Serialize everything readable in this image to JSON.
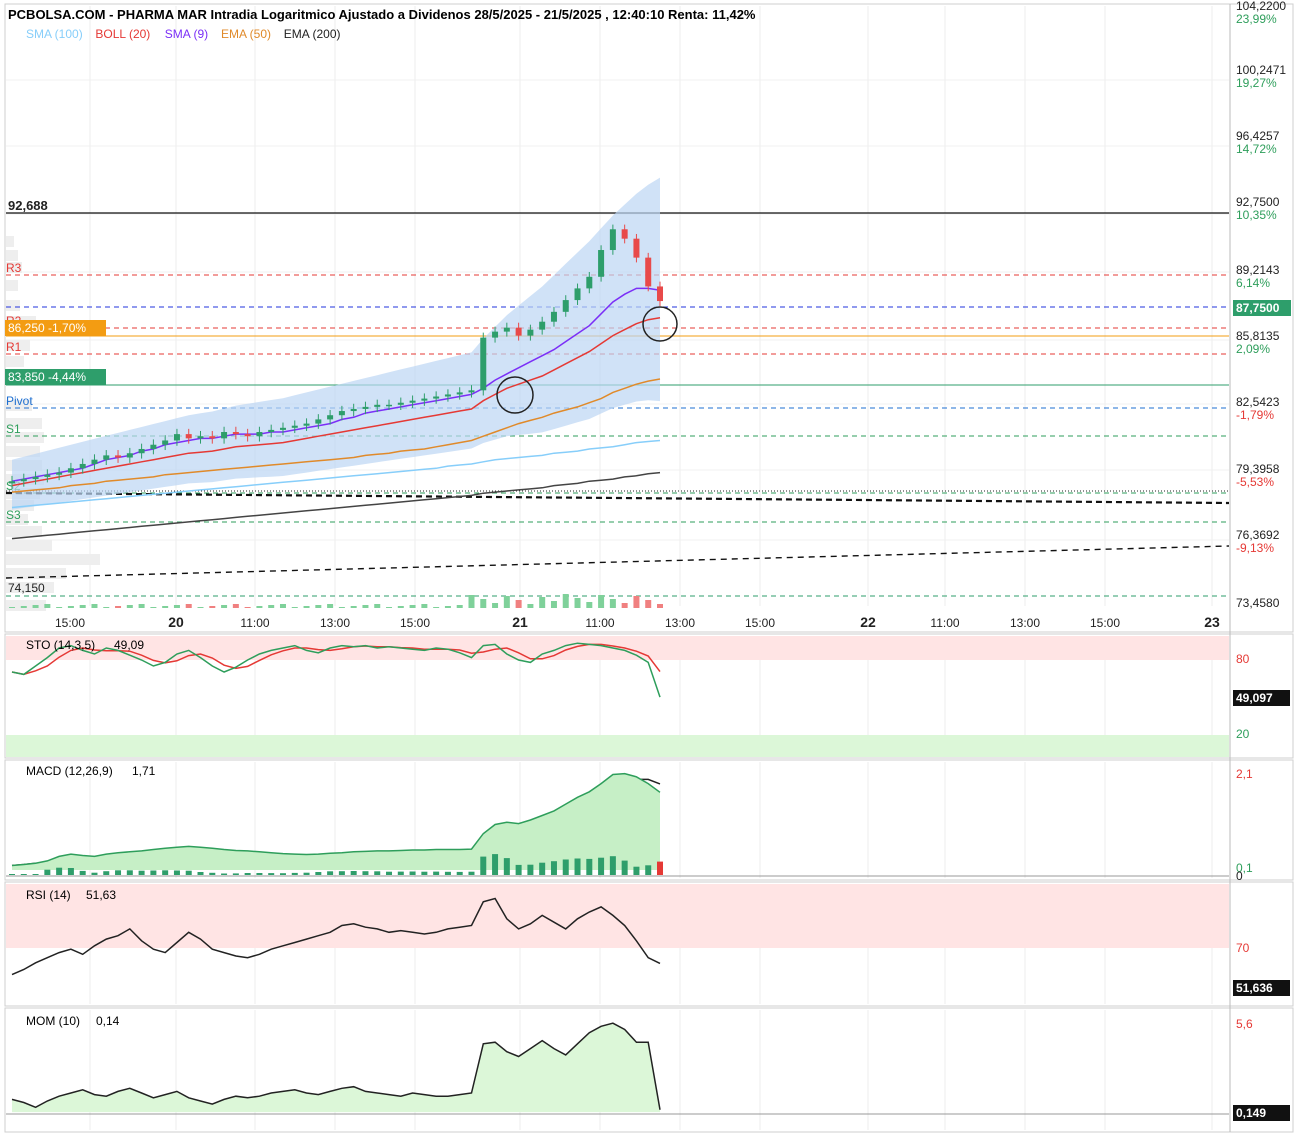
{
  "title": "PCBOLSA.COM - PHARMA MAR Intradia Logaritmico Ajustado a Dividenos 28/5/2025 - 21/5/2025 , 12:40:10 Renta: 11,42%",
  "legend": [
    {
      "label": "SMA (100)",
      "color": "#87cefa"
    },
    {
      "label": "BOLL (20)",
      "color": "#e53935"
    },
    {
      "label": "SMA (9)",
      "color": "#7b2ff7"
    },
    {
      "label": "EMA (50)",
      "color": "#e08a2a"
    },
    {
      "label": "EMA (200)",
      "color": "#222222"
    }
  ],
  "price_axis": [
    {
      "value": "104,2200",
      "pct": "23,99%",
      "pct_color": "#2e9e5b"
    },
    {
      "value": "100,2471",
      "pct": "19,27%",
      "pct_color": "#2e9e5b"
    },
    {
      "value": "96,4257",
      "pct": "14,72%",
      "pct_color": "#2e9e5b"
    },
    {
      "value": "92,7500",
      "pct": "10,35%",
      "pct_color": "#2e9e5b"
    },
    {
      "value": "89,2143",
      "pct": "6,14%",
      "pct_color": "#2e9e5b"
    },
    {
      "value": "85,8135",
      "pct": "2,09%",
      "pct_color": "#2e9e5b"
    },
    {
      "value": "82,5423",
      "pct": "-1,79%",
      "pct_color": "#e53935"
    },
    {
      "value": "79,3958",
      "pct": "-5,53%",
      "pct_color": "#e53935"
    },
    {
      "value": "76,3692",
      "pct": "-9,13%",
      "pct_color": "#e53935"
    },
    {
      "value": "73,4580",
      "pct": "",
      "pct_color": "#e53935"
    }
  ],
  "last_price_label": "87,7500",
  "high_label": "92,688",
  "low_label": "74,150",
  "pivot_levels": [
    {
      "label": "R3",
      "color": "#e53935"
    },
    {
      "label": "R2",
      "color": "#e53935"
    },
    {
      "label": "R1",
      "color": "#e53935"
    },
    {
      "label": "Pivot",
      "color": "#1e6fd0"
    },
    {
      "label": "S1",
      "color": "#2e9e5b"
    },
    {
      "label": "S2",
      "color": "#2e9e5b"
    },
    {
      "label": "S3",
      "color": "#2e9e5b"
    }
  ],
  "marker_orange": "86,250 -1,70%",
  "marker_green": "83,850 -4,44%",
  "time_axis": [
    "15:00",
    "20",
    "11:00",
    "13:00",
    "15:00",
    "21",
    "11:00",
    "13:00",
    "15:00",
    "22",
    "11:00",
    "13:00",
    "15:00",
    "23"
  ],
  "indicators": {
    "sto": {
      "title": "STO (14,3,5)",
      "value": "49,09",
      "box": "49,097",
      "levels": [
        "80",
        "20"
      ]
    },
    "macd": {
      "title": "MACD (12,26,9)",
      "value": "1,71",
      "levels": [
        "2,1",
        "0,1",
        "0"
      ]
    },
    "rsi": {
      "title": "RSI (14)",
      "value": "51,63",
      "box": "51,636",
      "levels": [
        "70"
      ]
    },
    "mom": {
      "title": "MOM (10)",
      "value": "0,14",
      "box": "0,149",
      "levels": [
        "5,6"
      ]
    }
  },
  "chart_data": {
    "type": "line",
    "title": "PCBOLSA.COM - PHARMA MAR Intradia Logaritmico Ajustado a Dividenos 28/5/2025 - 21/5/2025 , 12:40:10 Renta: 11,42%",
    "x_ticks": [
      "15:00",
      "20",
      "11:00",
      "13:00",
      "15:00",
      "21",
      "11:00",
      "13:00",
      "15:00",
      "22",
      "11:00",
      "13:00",
      "15:00",
      "23"
    ],
    "y_scale": "log",
    "ylim": [
      73.458,
      104.22
    ],
    "candles_close": [
      79.0,
      79.1,
      79.2,
      79.3,
      79.4,
      79.6,
      79.8,
      80.0,
      80.2,
      80.1,
      80.3,
      80.5,
      80.7,
      80.9,
      81.2,
      81.0,
      81.1,
      81.0,
      81.3,
      81.2,
      81.1,
      81.3,
      81.4,
      81.5,
      81.6,
      81.7,
      81.9,
      82.1,
      82.3,
      82.4,
      82.5,
      82.6,
      82.6,
      82.7,
      82.8,
      82.9,
      83.0,
      83.1,
      83.2,
      83.3,
      85.9,
      86.2,
      86.4,
      86.0,
      86.3,
      86.7,
      87.2,
      87.8,
      88.4,
      89.0,
      90.4,
      91.5,
      91.0,
      90.0,
      88.5,
      87.75
    ],
    "sma9": [
      79.0,
      79.1,
      79.2,
      79.3,
      79.4,
      79.5,
      79.6,
      79.8,
      80.0,
      80.1,
      80.2,
      80.4,
      80.5,
      80.7,
      80.8,
      80.9,
      81.0,
      81.0,
      81.1,
      81.2,
      81.2,
      81.2,
      81.3,
      81.3,
      81.4,
      81.5,
      81.6,
      81.7,
      81.9,
      82.0,
      82.2,
      82.3,
      82.4,
      82.5,
      82.6,
      82.7,
      82.8,
      82.9,
      83.0,
      83.1,
      83.4,
      83.8,
      84.1,
      84.4,
      84.7,
      85.0,
      85.3,
      85.7,
      86.1,
      86.5,
      87.1,
      87.7,
      88.1,
      88.4,
      88.4,
      88.3
    ],
    "ema50": [
      78.5,
      78.55,
      78.6,
      78.65,
      78.7,
      78.8,
      78.85,
      78.9,
      79.0,
      79.05,
      79.1,
      79.15,
      79.2,
      79.3,
      79.35,
      79.4,
      79.45,
      79.5,
      79.55,
      79.6,
      79.65,
      79.7,
      79.75,
      79.8,
      79.85,
      79.9,
      79.95,
      80.0,
      80.05,
      80.1,
      80.2,
      80.25,
      80.3,
      80.4,
      80.45,
      80.5,
      80.6,
      80.7,
      80.8,
      80.9,
      81.1,
      81.3,
      81.5,
      81.7,
      81.85,
      82.0,
      82.2,
      82.35,
      82.5,
      82.7,
      82.9,
      83.2,
      83.4,
      83.6,
      83.75,
      83.85
    ],
    "series_mid_boll": [
      78.8,
      78.9,
      79.0,
      79.1,
      79.2,
      79.3,
      79.4,
      79.5,
      79.6,
      79.7,
      79.8,
      79.9,
      80.0,
      80.1,
      80.2,
      80.3,
      80.35,
      80.4,
      80.5,
      80.6,
      80.65,
      80.7,
      80.75,
      80.8,
      80.9,
      81.0,
      81.1,
      81.2,
      81.3,
      81.4,
      81.5,
      81.6,
      81.7,
      81.8,
      81.9,
      82.0,
      82.1,
      82.2,
      82.3,
      82.4,
      82.8,
      83.1,
      83.4,
      83.6,
      83.8,
      84.0,
      84.3,
      84.6,
      84.9,
      85.2,
      85.6,
      86.0,
      86.3,
      86.6,
      86.8,
      86.9
    ],
    "sma100": [
      77.8,
      77.85,
      77.9,
      77.95,
      78.0,
      78.05,
      78.1,
      78.15,
      78.2,
      78.25,
      78.3,
      78.35,
      78.4,
      78.45,
      78.5,
      78.55,
      78.6,
      78.65,
      78.7,
      78.75,
      78.8,
      78.85,
      78.9,
      78.95,
      79.0,
      79.05,
      79.1,
      79.15,
      79.2,
      79.25,
      79.3,
      79.35,
      79.4,
      79.45,
      79.5,
      79.55,
      79.6,
      79.7,
      79.75,
      79.8,
      79.9,
      80.0,
      80.05,
      80.1,
      80.15,
      80.2,
      80.3,
      80.35,
      80.4,
      80.5,
      80.55,
      80.6,
      80.7,
      80.8,
      80.85,
      80.9
    ],
    "ema200": [
      76.4,
      76.45,
      76.5,
      76.55,
      76.6,
      76.65,
      76.7,
      76.75,
      76.8,
      76.85,
      76.9,
      76.95,
      77.0,
      77.05,
      77.1,
      77.15,
      77.2,
      77.25,
      77.3,
      77.35,
      77.4,
      77.45,
      77.5,
      77.55,
      77.6,
      77.65,
      77.7,
      77.75,
      77.8,
      77.85,
      77.9,
      77.95,
      78.0,
      78.05,
      78.1,
      78.15,
      78.2,
      78.25,
      78.3,
      78.35,
      78.45,
      78.5,
      78.55,
      78.6,
      78.65,
      78.7,
      78.8,
      78.85,
      78.9,
      79.0,
      79.05,
      79.1,
      79.2,
      79.25,
      79.35,
      79.4
    ],
    "sto": [
      70,
      68,
      75,
      82,
      90,
      92,
      88,
      85,
      90,
      88,
      84,
      80,
      75,
      78,
      85,
      88,
      82,
      75,
      70,
      74,
      80,
      85,
      88,
      90,
      92,
      88,
      86,
      90,
      92,
      91,
      92,
      90,
      91,
      90,
      89,
      88,
      90,
      89,
      86,
      82,
      92,
      93,
      85,
      80,
      78,
      85,
      88,
      92,
      94,
      93,
      92,
      90,
      88,
      84,
      78,
      49.09
    ],
    "macd": [
      0.1,
      0.12,
      0.15,
      0.2,
      0.3,
      0.35,
      0.32,
      0.3,
      0.35,
      0.38,
      0.4,
      0.42,
      0.45,
      0.48,
      0.5,
      0.52,
      0.5,
      0.48,
      0.45,
      0.43,
      0.42,
      0.4,
      0.38,
      0.36,
      0.35,
      0.34,
      0.35,
      0.37,
      0.38,
      0.4,
      0.41,
      0.42,
      0.42,
      0.43,
      0.44,
      0.44,
      0.45,
      0.45,
      0.45,
      0.46,
      0.8,
      1.0,
      1.05,
      1.02,
      1.1,
      1.2,
      1.3,
      1.45,
      1.6,
      1.72,
      1.9,
      2.1,
      2.12,
      2.05,
      1.9,
      1.71
    ],
    "rsi": [
      45,
      48,
      52,
      55,
      58,
      60,
      57,
      62,
      66,
      68,
      72,
      65,
      60,
      58,
      64,
      70,
      66,
      60,
      58,
      56,
      55,
      57,
      60,
      62,
      64,
      66,
      68,
      70,
      74,
      75,
      73,
      72,
      70,
      71,
      70,
      69,
      70,
      72,
      73,
      74,
      88,
      90,
      78,
      72,
      75,
      80,
      76,
      72,
      78,
      82,
      85,
      80,
      74,
      65,
      55,
      51.63
    ],
    "mom": [
      0.8,
      0.6,
      0.3,
      0.7,
      1.0,
      1.2,
      1.4,
      1.1,
      1.0,
      1.3,
      1.5,
      1.2,
      0.9,
      1.1,
      1.3,
      0.9,
      0.7,
      0.5,
      0.8,
      1.0,
      0.9,
      1.0,
      1.2,
      1.3,
      1.4,
      1.2,
      1.1,
      1.3,
      1.5,
      1.6,
      1.3,
      1.2,
      1.1,
      1.0,
      1.2,
      1.1,
      1.0,
      1.0,
      1.1,
      1.2,
      4.3,
      4.4,
      3.8,
      3.5,
      4.0,
      4.5,
      4.0,
      3.6,
      4.3,
      5.0,
      5.4,
      5.6,
      5.2,
      4.4,
      4.4,
      0.14
    ]
  }
}
